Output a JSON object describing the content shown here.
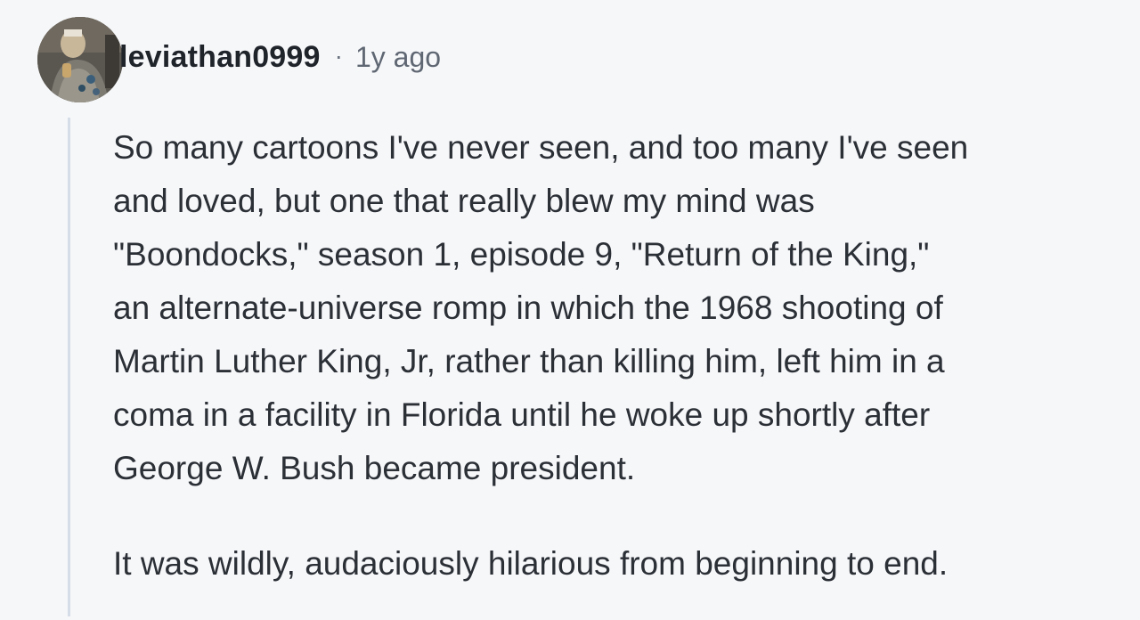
{
  "comment": {
    "username": "leviathan0999",
    "separator": "·",
    "timestamp": "1y ago",
    "avatar_icon": "user-avatar-photo",
    "body_lines": [
      "So many cartoons I've never seen, and too many I've seen",
      "and loved, but one that really blew my mind was",
      "\"Boondocks,\" season 1, episode 9, \"Return of the King,\"",
      "an alternate-universe romp in which the 1968 shooting of",
      "Martin Luther King, Jr, rather than killing him, left him in a",
      "coma in a facility in Florida until he woke up shortly after",
      "George W. Bush became president."
    ],
    "paragraph_2": "It was wildly, audaciously hilarious from beginning to end."
  },
  "colors": {
    "background": "#f6f7f9",
    "thread_line": "#d5dde8",
    "username": "#1f232a",
    "meta": "#5f6773",
    "body_text": "#2b2f36"
  }
}
